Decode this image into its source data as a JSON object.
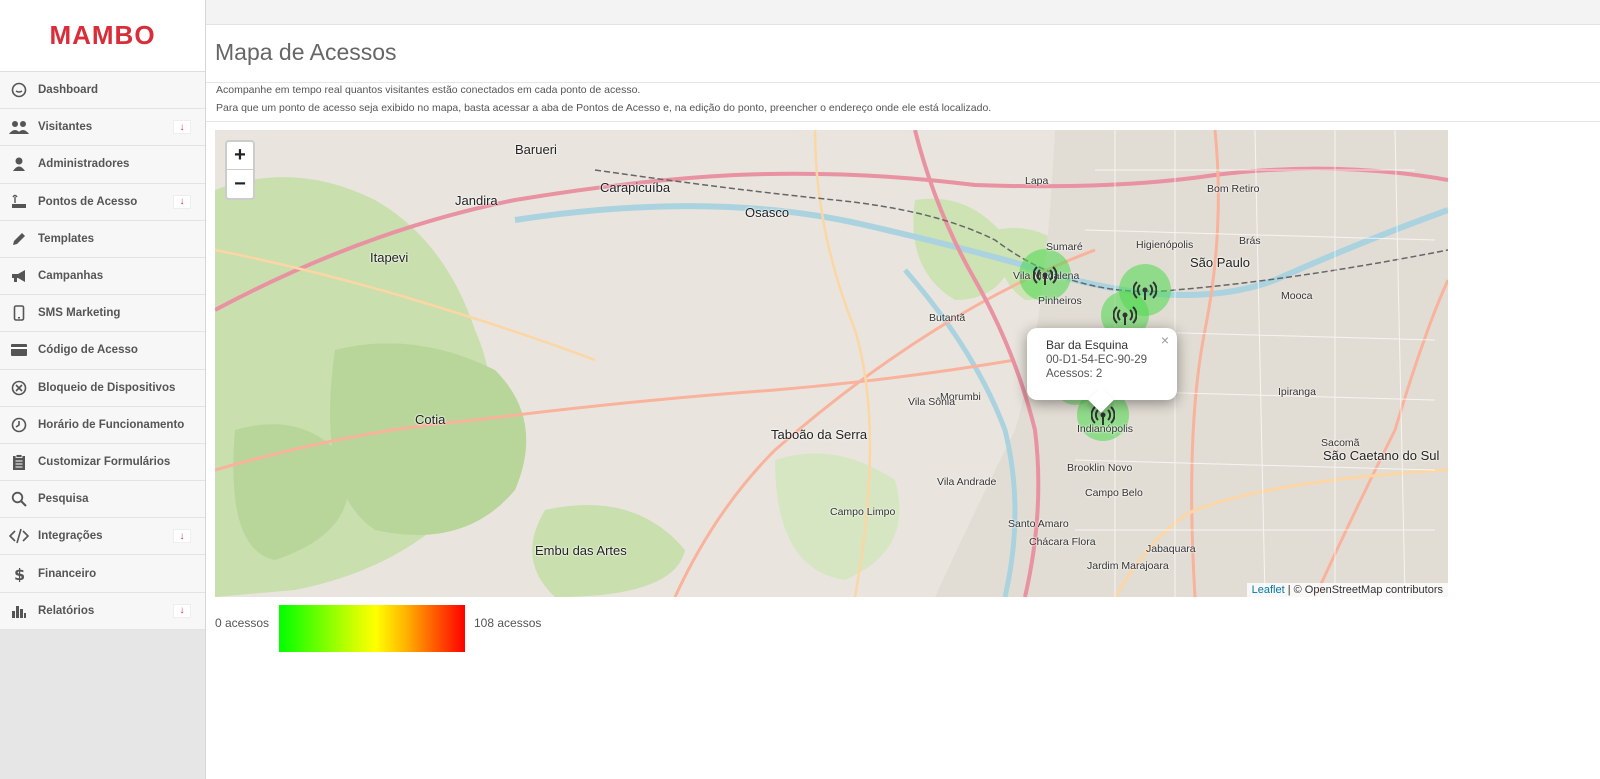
{
  "brand": {
    "logo": "MAMBO",
    "accent": "#d92d3a"
  },
  "sidebar": {
    "items": [
      {
        "label": "Dashboard",
        "icon": "dashboard-icon",
        "caret": false
      },
      {
        "label": "Visitantes",
        "icon": "users-icon",
        "caret": true
      },
      {
        "label": "Administradores",
        "icon": "user-icon",
        "caret": false
      },
      {
        "label": "Pontos de Acesso",
        "icon": "router-icon",
        "caret": true
      },
      {
        "label": "Templates",
        "icon": "pencil-icon",
        "caret": false
      },
      {
        "label": "Campanhas",
        "icon": "megaphone-icon",
        "caret": false
      },
      {
        "label": "SMS Marketing",
        "icon": "phone-icon",
        "caret": false
      },
      {
        "label": "Código de Acesso",
        "icon": "card-icon",
        "caret": false
      },
      {
        "label": "Bloqueio de Dispositivos",
        "icon": "block-icon",
        "caret": false
      },
      {
        "label": "Horário de Funcionamento",
        "icon": "clock-icon",
        "caret": false
      },
      {
        "label": "Customizar Formulários",
        "icon": "clipboard-icon",
        "caret": false
      },
      {
        "label": "Pesquisa",
        "icon": "search-icon",
        "caret": false
      },
      {
        "label": "Integrações",
        "icon": "code-icon",
        "caret": true
      },
      {
        "label": "Financeiro",
        "icon": "dollar-icon",
        "caret": false
      },
      {
        "label": "Relatórios",
        "icon": "bar-chart-icon",
        "caret": true
      }
    ]
  },
  "page": {
    "title": "Mapa de Acessos",
    "desc1": "Acompanhe em tempo real quantos visitantes estão conectados em cada ponto de acesso.",
    "desc2": "Para que um ponto de acesso seja exibido no mapa, basta acessar a aba de Pontos de Acesso e, na edição do ponto, preencher o endereço onde ele está localizado."
  },
  "map": {
    "zoom_in": "+",
    "zoom_out": "−",
    "labels": [
      "Barueri",
      "Carapicuíba",
      "Osasco",
      "Jandira",
      "Itapevi",
      "São Paulo",
      "Taboão da Serra",
      "Embu das Artes",
      "Cotia",
      "Mooca",
      "Ipiranga",
      "Campo Belo",
      "Pinheiros",
      "Butantã",
      "Morumbi",
      "Santo Amaro",
      "Vila Madalena",
      "Sumaré",
      "Higienópolis",
      "Bom Retiro",
      "Brás",
      "Lapa",
      "Vila Sônia",
      "São Caetano do Sul",
      "Sacomã",
      "Indianópolis",
      "Brooklin Novo",
      "Jabaquara",
      "Vila Andrade",
      "Campo Limpo",
      "Jardim Marajoara",
      "Chácara Flora"
    ],
    "popup": {
      "title": "Bar da Esquina",
      "mac": "00-D1-54-EC-90-29",
      "accesses": "Acessos: 2",
      "close": "×"
    },
    "attribution_link": "Leaflet",
    "attribution_text": " | © OpenStreetMap contributors"
  },
  "legend": {
    "min": "0 acessos",
    "max": "108 acessos"
  }
}
